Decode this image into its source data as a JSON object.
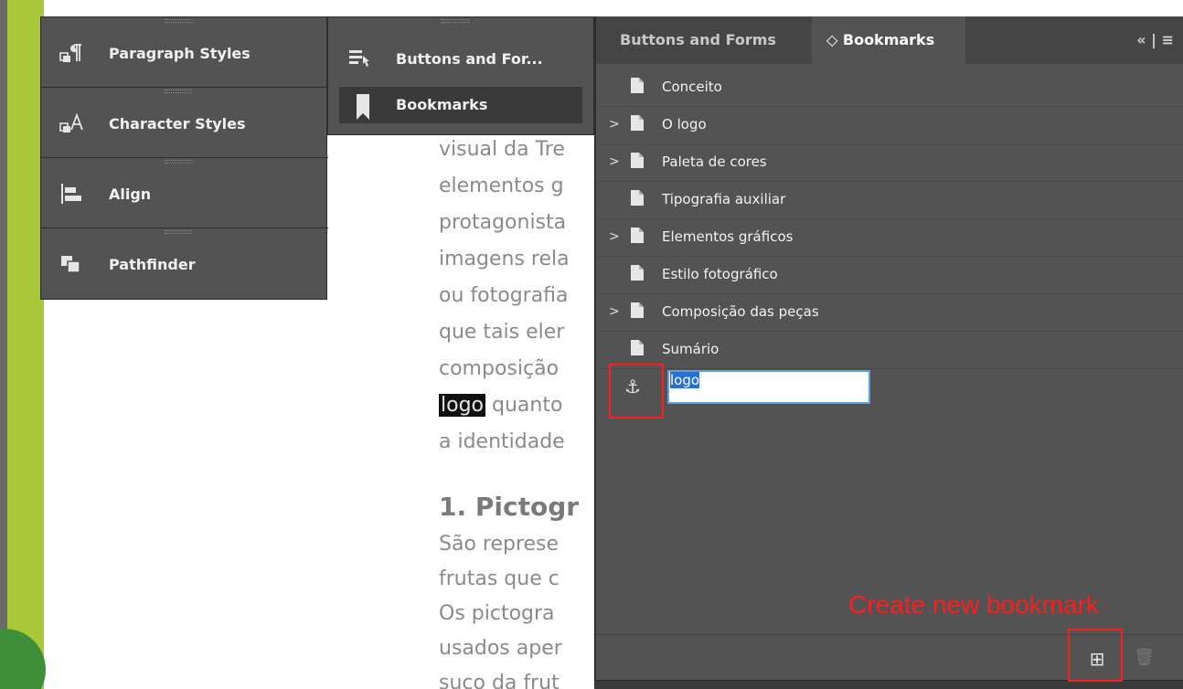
{
  "document": {
    "lines": [
      "visual da Tre",
      "elementos g",
      "protagonista",
      "imagens rela",
      "ou fotografia",
      "que tais eler",
      "composição",
      "a identidade"
    ],
    "logo_word": "logo",
    "logo_line_rest": " quanto",
    "heading": "1. Pictogr",
    "lines_after": [
      " São represe",
      "frutas que c",
      " Os pictogra",
      "usados aper",
      "suco da frut"
    ]
  },
  "left_dock": {
    "items": [
      {
        "label": "Paragraph Styles",
        "icon": "paragraph-styles-icon"
      },
      {
        "label": "Character Styles",
        "icon": "character-styles-icon"
      },
      {
        "label": "Align",
        "icon": "align-icon"
      },
      {
        "label": "Pathfinder",
        "icon": "pathfinder-icon"
      }
    ]
  },
  "mid_dock": {
    "items": [
      {
        "label": "Buttons and For...",
        "icon": "buttons-forms-icon"
      },
      {
        "label": "Bookmarks",
        "icon": "bookmark-icon"
      }
    ]
  },
  "bookmarks_panel": {
    "tabs": [
      {
        "label": "Buttons and Forms"
      },
      {
        "label": "◇ Bookmarks"
      }
    ],
    "tab_controls": "«  |  ≡",
    "items": [
      {
        "label": "Conceito",
        "expandable": false
      },
      {
        "label": "O logo",
        "expandable": true
      },
      {
        "label": "Paleta de cores",
        "expandable": true
      },
      {
        "label": "Tipografia auxiliar",
        "expandable": false
      },
      {
        "label": "Elementos gráficos",
        "expandable": true
      },
      {
        "label": "Estilo fotográfico",
        "expandable": false
      },
      {
        "label": "Composição das peças",
        "expandable": true
      },
      {
        "label": "Sumário",
        "expandable": false
      }
    ],
    "new_item_value": "logo",
    "annotation": "Create new bookmark",
    "chevron": ">",
    "anchor_glyph": "⚓",
    "new_button_glyph": "⊞",
    "trash_glyph": "🗑"
  },
  "colors": {
    "panel_bg": "#535353",
    "tabbar_bg": "#454545",
    "highlight_red": "#ff1c1c",
    "selection_blue": "#2a6fd4",
    "green_accent": "#a8c83a"
  }
}
